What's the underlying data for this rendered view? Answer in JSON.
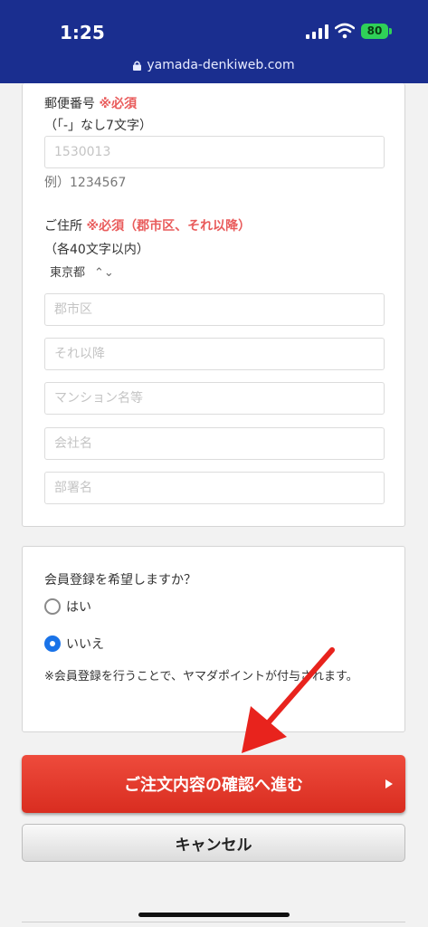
{
  "status_bar": {
    "time": "1:25",
    "url": "yamada-denkiweb.com",
    "battery": "80"
  },
  "address_form": {
    "postal_label": "郵便番号",
    "postal_required": "※必須",
    "postal_note": "（「-」なし7文字）",
    "postal_placeholder": "1530013",
    "postal_example": "例）1234567",
    "address_label": "ご住所",
    "address_required": "※必須（郡市区、それ以降）",
    "address_note": "（各40文字以内）",
    "prefecture": "東京都",
    "city_placeholder": "郡市区",
    "street_placeholder": "それ以降",
    "building_placeholder": "マンション名等",
    "company_placeholder": "会社名",
    "department_placeholder": "部署名"
  },
  "membership": {
    "question": "会員登録を希望しますか？",
    "option_yes": "はい",
    "option_no": "いいえ",
    "selected": "いいえ",
    "note": "※会員登録を行うことで、ヤマダポイントが付与されます。"
  },
  "actions": {
    "confirm_label": "ご注文内容の確認へ進む",
    "cancel_label": "キャンセル"
  },
  "colors": {
    "header": "#1a2e8f",
    "required": "#e95c5c",
    "confirm": "#e23a2c",
    "radio_selected": "#1a73e8",
    "annotation_arrow": "#e8231d"
  }
}
